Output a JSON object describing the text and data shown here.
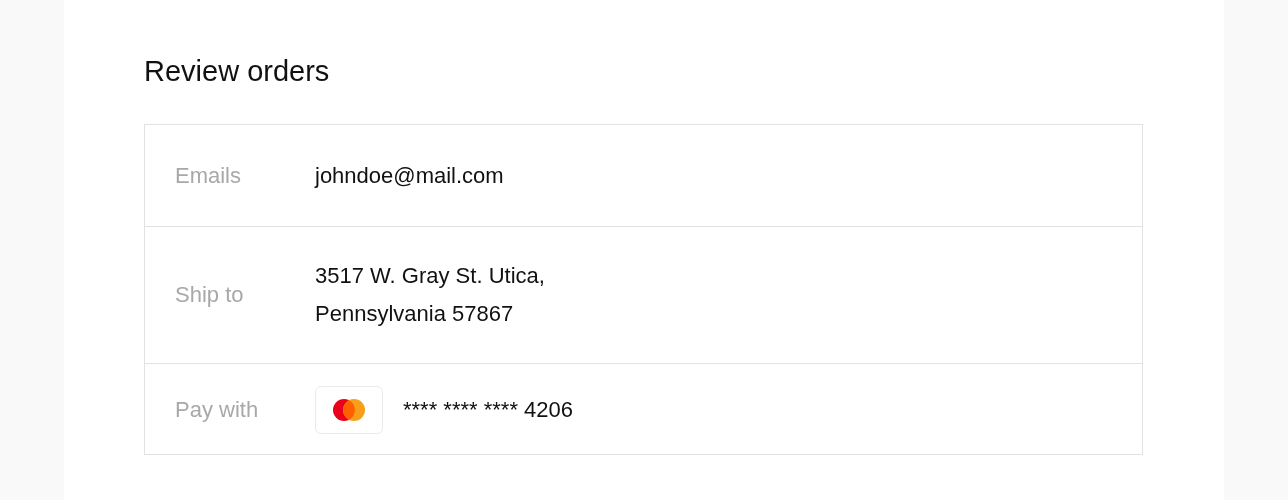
{
  "title": "Review orders",
  "rows": [
    {
      "label": "Emails",
      "kind": "text",
      "lines": [
        "johndoe@mail.com"
      ]
    },
    {
      "label": "Ship to",
      "kind": "text",
      "lines": [
        "3517 W. Gray St. Utica,",
        "Pennsylvania 57867"
      ]
    },
    {
      "label": "Pay with",
      "kind": "card",
      "number": "**** **** **** 4206"
    }
  ]
}
